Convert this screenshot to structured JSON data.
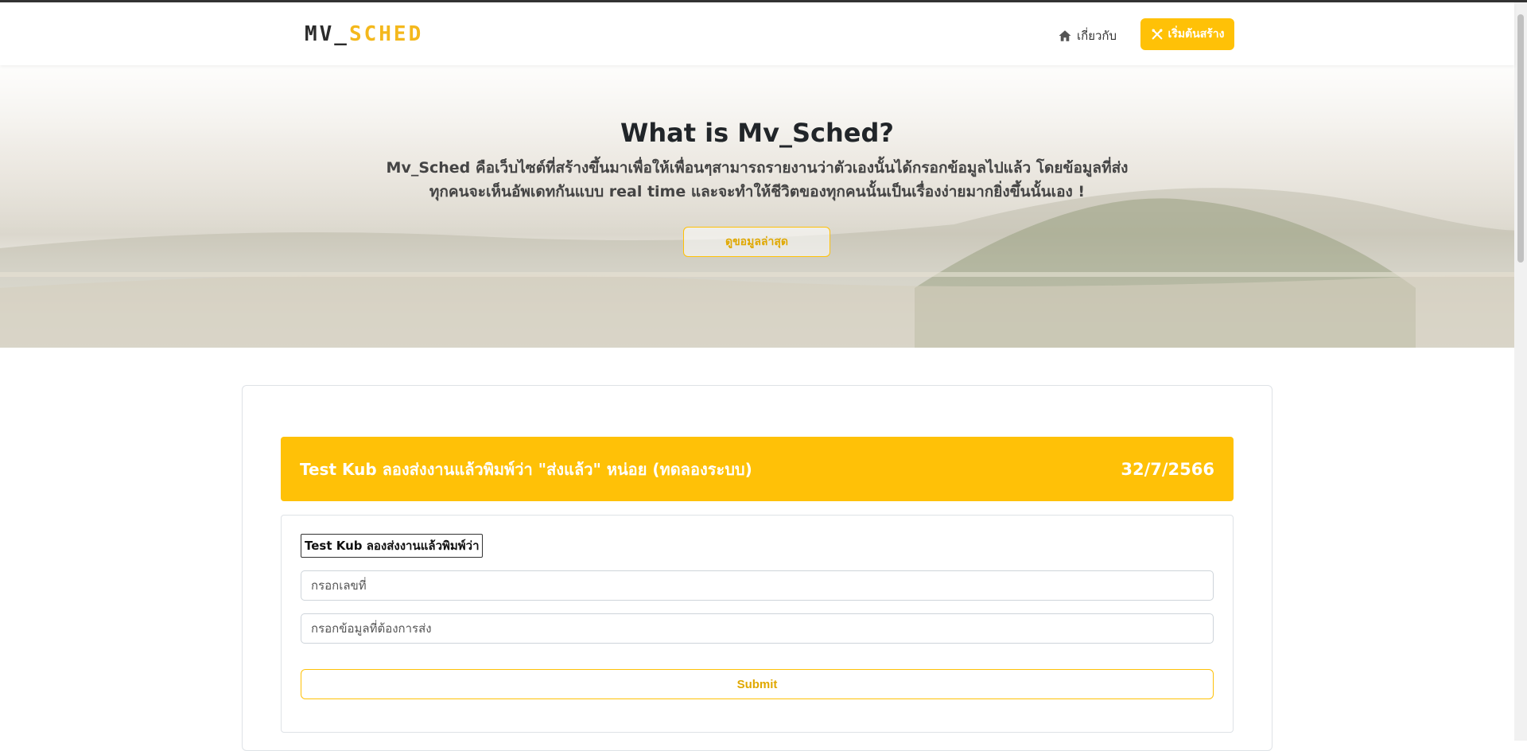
{
  "navbar": {
    "logo_part1": "MV_",
    "logo_part2": "SCHED",
    "about_label": "เกี่ยวกับ",
    "start_label": "เริ่มต้นสร้าง"
  },
  "hero": {
    "title": "What is Mv_Sched?",
    "line1": "Mv_Sched คือเว็บไซต์ที่สร้างขึ้นมาเพื่อให้เพื่อนๆสามารถรายงานว่าตัวเองนั้นได้กรอกข้อมูลไปแล้ว โดยข้อมูลที่ส่ง",
    "line2": "ทุกคนจะเห็นอัพเดทกันแบบ real time และจะทำให้ชีวิตของทุกคนนั้นเป็นเรื่องง่ายมากยิ่งขึ้นนั้นเอง !",
    "button_label": "ดูขอมูลล่าสุด"
  },
  "task": {
    "title": "Test Kub ลองส่งงานแล้วพิมพ์ว่า \"ส่งแล้ว\" หน่อย (ทดลองระบบ)",
    "date": "32/7/2566",
    "tag_value": "Test Kub ลองส่งงานแล้วพิมพ์ว่า",
    "number_placeholder": "กรอกเลขที่",
    "data_placeholder": "กรอกข้อมูลที่ต้องการส่ง",
    "submit_label": "Submit"
  },
  "colors": {
    "accent": "#ffc107",
    "logo_accent": "#f4b81c",
    "text_dark": "#212529"
  },
  "icons": {
    "about": "home-icon",
    "start": "tools-icon"
  }
}
